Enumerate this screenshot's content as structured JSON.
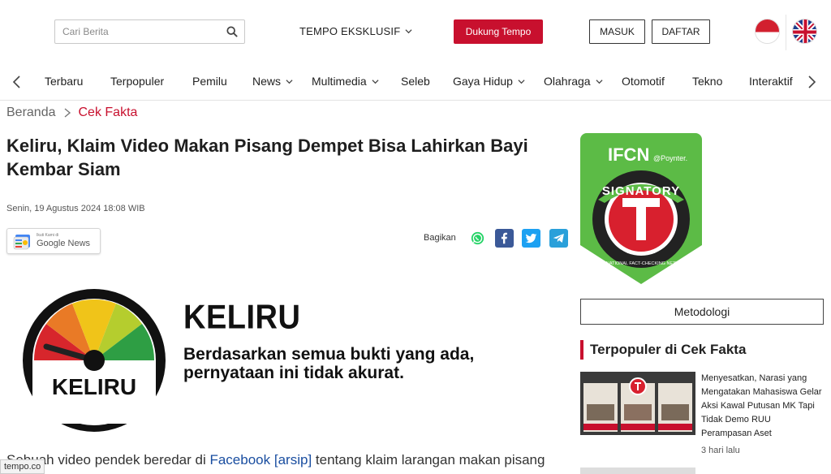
{
  "header": {
    "search_placeholder": "Cari Berita",
    "exclusive_label": "TEMPO EKSKLUSIF",
    "support_button": "Dukung Tempo",
    "login_button": "MASUK",
    "register_button": "DAFTAR",
    "accent_color": "#c8102e"
  },
  "nav": {
    "items": [
      "Terbaru",
      "Terpopuler",
      "Pemilu",
      "News",
      "Multimedia",
      "Seleb",
      "Gaya Hidup",
      "Olahraga",
      "Otomotif",
      "Tekno",
      "Interaktif"
    ],
    "dropdown_items": [
      "News",
      "Multimedia",
      "Gaya Hidup",
      "Olahraga"
    ]
  },
  "breadcrumb": {
    "home": "Beranda",
    "current": "Cek Fakta"
  },
  "article": {
    "title": "Keliru, Klaim Video Makan Pisang Dempet Bisa Lahirkan Bayi Kembar Siam",
    "date": "Senin, 19 Agustus 2024 18:08 WIB",
    "google_news_small": "Ikuti Kami di",
    "google_news_label": "Google News",
    "share_label": "Bagikan",
    "share_icons": [
      "whatsapp-icon",
      "facebook-icon",
      "twitter-icon",
      "telegram-icon"
    ],
    "verdict": {
      "word": "KELIRU",
      "gauge_label": "KELIRU",
      "description": "Berdasarkan semua bukti yang ada, pernyataan ini tidak akurat."
    },
    "body_before": "Sebuah video pendek beredar di ",
    "body_link1": "Facebook",
    "body_link2": "[arsip]",
    "body_after": " tentang klaim larangan makan pisang"
  },
  "status_bar": "tempo.co",
  "sidebar": {
    "badge": {
      "brand": "IFCN",
      "partner": "@Poynter.",
      "ribbon": "SIGNATORY",
      "ring_text": "INTERNATIONAL FACT-CHECKING NETWORK",
      "letter": "T"
    },
    "methodology_button": "Metodologi",
    "popular_title": "Terpopuler di Cek Fakta",
    "popular": [
      {
        "headline": "Menyesatkan, Narasi yang Mengatakan Mahasiswa Gelar Aksi Kawal Putusan MK Tapi Tidak Demo RUU Perampasan Aset",
        "time": "3 hari lalu"
      }
    ]
  }
}
